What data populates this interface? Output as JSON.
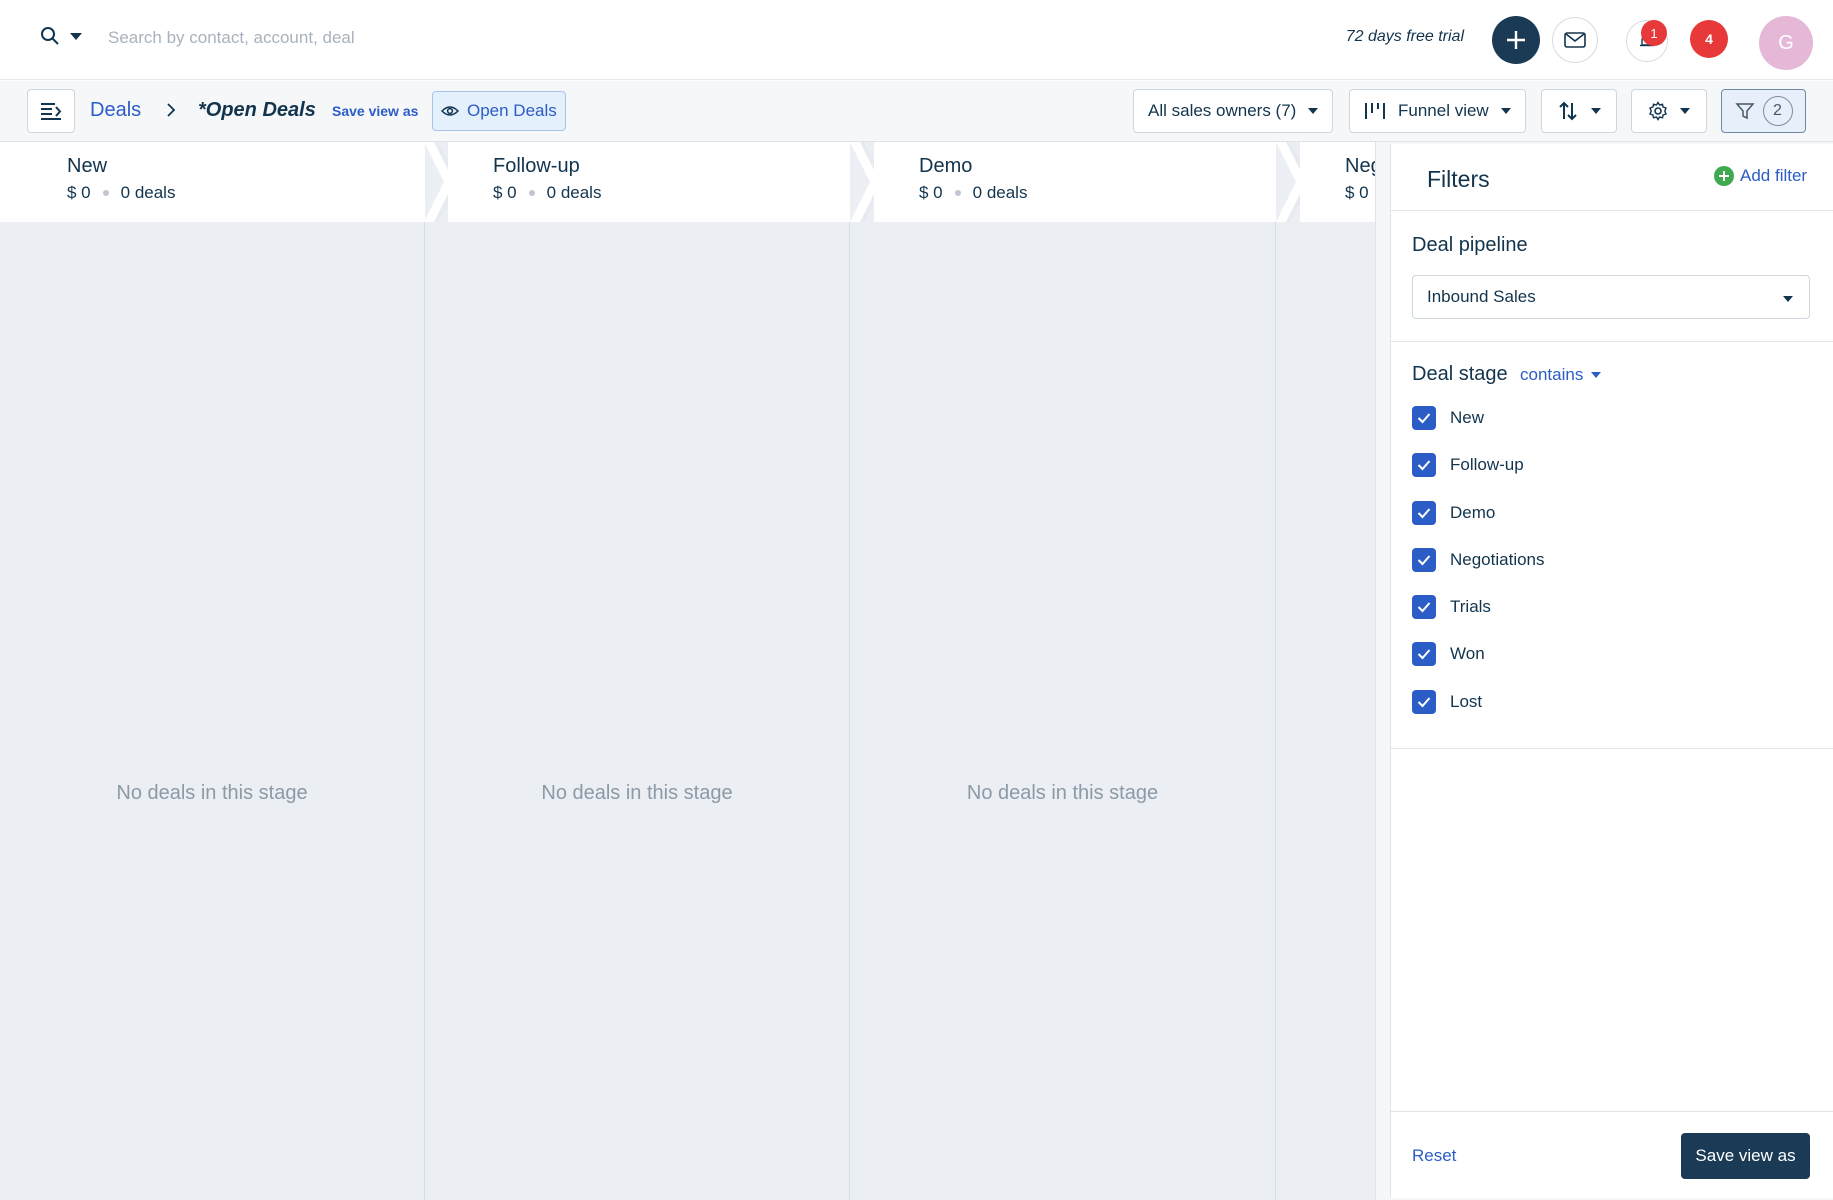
{
  "header": {
    "search_placeholder": "Search by contact, account, deal",
    "trial_text": "72 days free trial",
    "notification_count": "1",
    "alert_count": "4",
    "avatar_initial": "G"
  },
  "toolbar": {
    "breadcrumb_root": "Deals",
    "view_name": "*Open Deals",
    "save_view_as_link": "Save view as",
    "view_chip": "Open Deals",
    "sales_owners": "All sales owners (7)",
    "view_mode": "Funnel view",
    "filter_count": "2"
  },
  "stages": [
    {
      "name": "New",
      "amount": "$ 0",
      "deals": "0 deals",
      "empty_text": "No deals in this stage"
    },
    {
      "name": "Follow-up",
      "amount": "$ 0",
      "deals": "0 deals",
      "empty_text": "No deals in this stage"
    },
    {
      "name": "Demo",
      "amount": "$ 0",
      "deals": "0 deals",
      "empty_text": "No deals in this stage"
    },
    {
      "name": "Neg",
      "amount": "$ 0"
    }
  ],
  "filters": {
    "title": "Filters",
    "add_filter": "Add filter",
    "pipeline_label": "Deal pipeline",
    "pipeline_value": "Inbound Sales",
    "stage_label": "Deal stage",
    "stage_operator": "contains",
    "stage_options": [
      {
        "label": "New",
        "checked": true
      },
      {
        "label": "Follow-up",
        "checked": true
      },
      {
        "label": "Demo",
        "checked": true
      },
      {
        "label": "Negotiations",
        "checked": true
      },
      {
        "label": "Trials",
        "checked": true
      },
      {
        "label": "Won",
        "checked": true
      },
      {
        "label": "Lost",
        "checked": true
      }
    ],
    "reset": "Reset",
    "save_view_as": "Save view as"
  },
  "colors": {
    "brand_dark": "#1b3a55",
    "link_blue": "#2c5cc5",
    "badge_red": "#e8393a",
    "add_green": "#3fa94f",
    "avatar_pink": "#e6b8d8"
  }
}
